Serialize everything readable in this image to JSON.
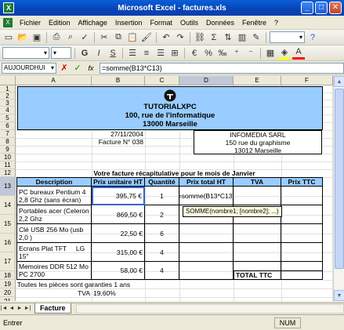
{
  "window": {
    "title": "Microsoft Excel - factures.xls",
    "app_icon_label": "X",
    "btn_min": "_",
    "btn_max": "□",
    "btn_close": "✕"
  },
  "menu": [
    {
      "label": "Fichier"
    },
    {
      "label": "Edition"
    },
    {
      "label": "Affichage"
    },
    {
      "label": "Insertion"
    },
    {
      "label": "Format"
    },
    {
      "label": "Outils"
    },
    {
      "label": "Données"
    },
    {
      "label": "Fenêtre"
    },
    {
      "label": "?"
    }
  ],
  "toolbar": {
    "zoom_value": "",
    "font_value": ""
  },
  "formula_bar": {
    "name_box": "AUJOURDHUI",
    "formula": "=somme(B13*C13)",
    "cancel_icon": "✗",
    "accept_icon": "✓",
    "fx_label": "fx"
  },
  "columns": [
    "A",
    "B",
    "C",
    "D",
    "E",
    "F"
  ],
  "rows": [
    "1",
    "2",
    "3",
    "4",
    "5",
    "6",
    "7",
    "8",
    "9",
    "10",
    "11",
    "12",
    "13",
    "14",
    "15",
    "16",
    "17",
    "18",
    "19",
    "20",
    "21"
  ],
  "header_block": {
    "company": "TUTORIALXPC",
    "address1": "100, rue de l'informatique",
    "address2": "13000 Marseille"
  },
  "invoice": {
    "date": "27/11/2004",
    "number": "Facture N° 038"
  },
  "client": {
    "name": "INFOMEDIA SARL",
    "address1": "150 rue du graphisme",
    "address2": "13012 Marseille"
  },
  "table_title": "Votre facture récapitulative pour le mois de Janvier",
  "table_headers": [
    "Description",
    "Prix unitaire HT",
    "Quantité",
    "Prix total HT",
    "TVA",
    "Prix TTC"
  ],
  "items": [
    {
      "description": "PC bureaux Pentium 4 2,8 Ghz (sans écran)",
      "price": "395,75 €",
      "qty": "1",
      "total": "=somme(B13*C13)"
    },
    {
      "description": "Portables acer (Celeron 2,2 Ghz",
      "price": "869,50 €",
      "qty": "2",
      "total": ""
    },
    {
      "description": "Clé USB 256 Mo (usb 2,0 )",
      "price": "22,50 €",
      "qty": "6",
      "total": ""
    },
    {
      "description": "Ecrans Plat TFT     LG 15\"",
      "price": "315,00 €",
      "qty": "4",
      "total": ""
    },
    {
      "description": "Memoires DDR 512 Mo PC 2700",
      "price": "58,00 €",
      "qty": "4",
      "total": ""
    }
  ],
  "formula_tooltip": "SOMME(nombre1; [nombre2]; ...)",
  "total_ttc_label": "TOTAL TTC",
  "footer_note": "Toutes les pièces sont garanties 1 ans",
  "tva": {
    "label": "TVA",
    "value": "19,60%"
  },
  "sheet_tab": "Facture",
  "status": {
    "mode": "Entrer",
    "num": "NUM"
  },
  "colors": {
    "header_fill": "#99CCFF",
    "title_bar": "#0A5FD8",
    "selection": "#000000"
  }
}
